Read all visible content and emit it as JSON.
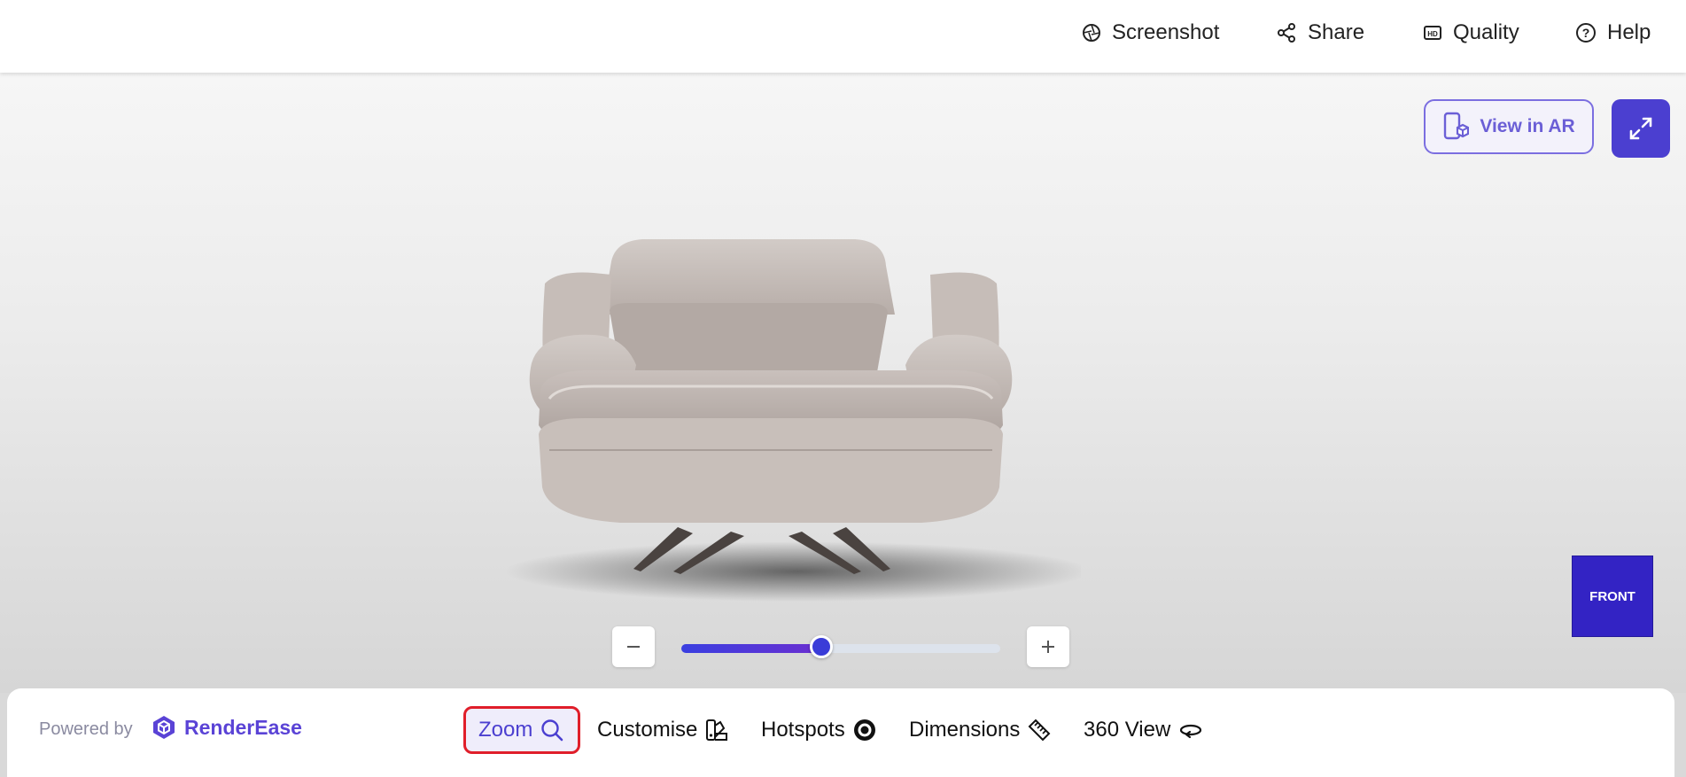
{
  "topbar": {
    "screenshot_label": "Screenshot",
    "share_label": "Share",
    "quality_label": "Quality",
    "help_label": "Help"
  },
  "viewer": {
    "ar_label": "View in AR",
    "cube_face": "FRONT",
    "zoom_level": 0.44
  },
  "footer": {
    "powered_by": "Powered by",
    "brand": "RenderEase",
    "tools": {
      "zoom": "Zoom",
      "customise": "Customise",
      "hotspots": "Hotspots",
      "dimensions": "Dimensions",
      "view360": "360 View"
    }
  },
  "colors": {
    "accent": "#4b3fd0",
    "cube": "#3323c4",
    "highlight_border": "#e01e2a"
  }
}
